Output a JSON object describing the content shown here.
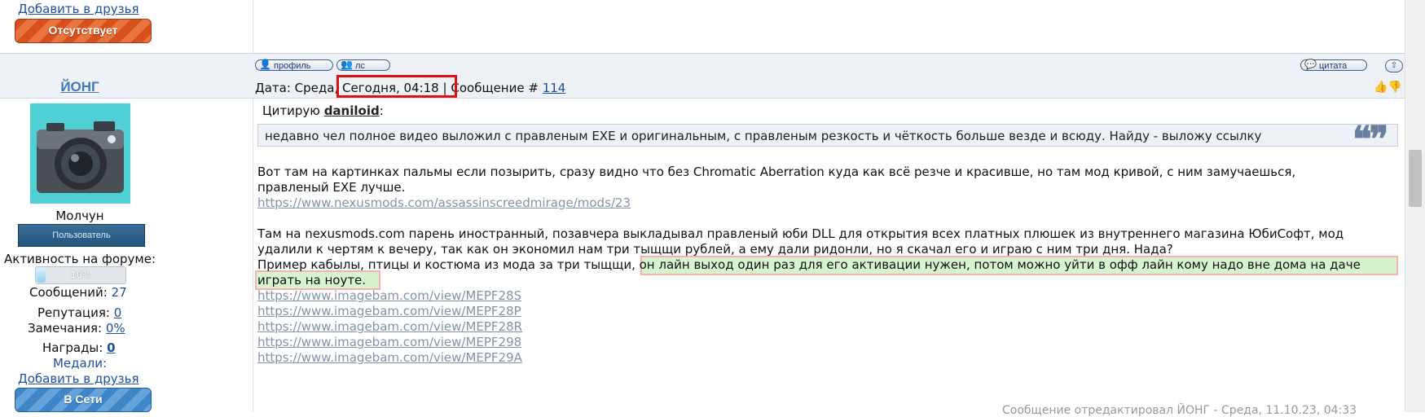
{
  "prev_user": {
    "add_friend": "Добавить в друзья",
    "status": "Отсутствует"
  },
  "toolbar": {
    "profile": "профиль",
    "pm": "лс",
    "quote": "цитата",
    "up": "⇧"
  },
  "post": {
    "username": "ЙОНГ",
    "date_label": "Дата: Среда,",
    "date_value": "Сегодня, 04:18",
    "sep": "|",
    "message_label": "Сообщение #",
    "message_number": "114",
    "vote_icons": "👍👎"
  },
  "user": {
    "title": "Молчун",
    "rank": "Пользователь",
    "activity_label": "Активность на форуме:",
    "activity_value": "10%",
    "activity_fraction": 0.1,
    "messages_label": "Сообщений:",
    "messages_value": "27",
    "reputation_label": "Репутация:",
    "reputation_value": "0",
    "warnings_label": "Замечания:",
    "warnings_value": "0%",
    "awards_label": "Награды:",
    "awards_value": "0",
    "medals_label": "Медали:",
    "add_friend": "Добавить в друзья",
    "status": "В Сети"
  },
  "quote": {
    "label": "Цитирую",
    "author": "daniloid",
    "colon": ":",
    "text": "недавно чел полное видео выложил с правленым EXE и оригинальным, с правленым резкость и чёткость больше везде и всюду. Найду - выложу ссылку",
    "mark": "❝❞"
  },
  "body": {
    "p1_line1": "Вот там на картинках пальмы если позырить, сразу видно что без Chromatic Aberration куда как всё резче и красивше, но там мод кривой, с ним замучаешься,",
    "p1_line2": "правленый EXE лучше.",
    "link1": "https://www.nexusmods.com/assassinscreedmirage/mods/23",
    "p2_line1": "Там на nexusmods.com парень иностранный, позавчера выкладывал правленый юби DLL для открытия всех платных плюшек из внутреннего магазина ЮбиСофт, мод",
    "p2_line2": "удалили к чертям к вечеру, так как он экономил нам три тыщщи рублей, а ему дали ридонли, но я скачал его и играю с ним три дня. Нада?",
    "p3_start": "Пример кабылы, птицы и костюма из мода за три тыщщи,",
    "p3_highlight1": " он лайн выход один раз для его активации нужен, потом можно уйти в офф лайн кому надо вне дома на даче",
    "p3_highlight2": "играть на ноуте.",
    "links": [
      "https://www.imagebam.com/view/MEPF28S",
      "https://www.imagebam.com/view/MEPF28P",
      "https://www.imagebam.com/view/MEPF28R",
      "https://www.imagebam.com/view/MEPF298",
      "https://www.imagebam.com/view/MEPF29A"
    ]
  },
  "footer_fragment": "Сообщение отредактировал ЙОНГ - Среда, 11.10.23, 04:33",
  "colors": {
    "accent_link": "#1f4f9e",
    "highlight_fill": "#d6f5cf",
    "highlight_border": "#f3b1b1",
    "date_box_border": "#e01010"
  }
}
